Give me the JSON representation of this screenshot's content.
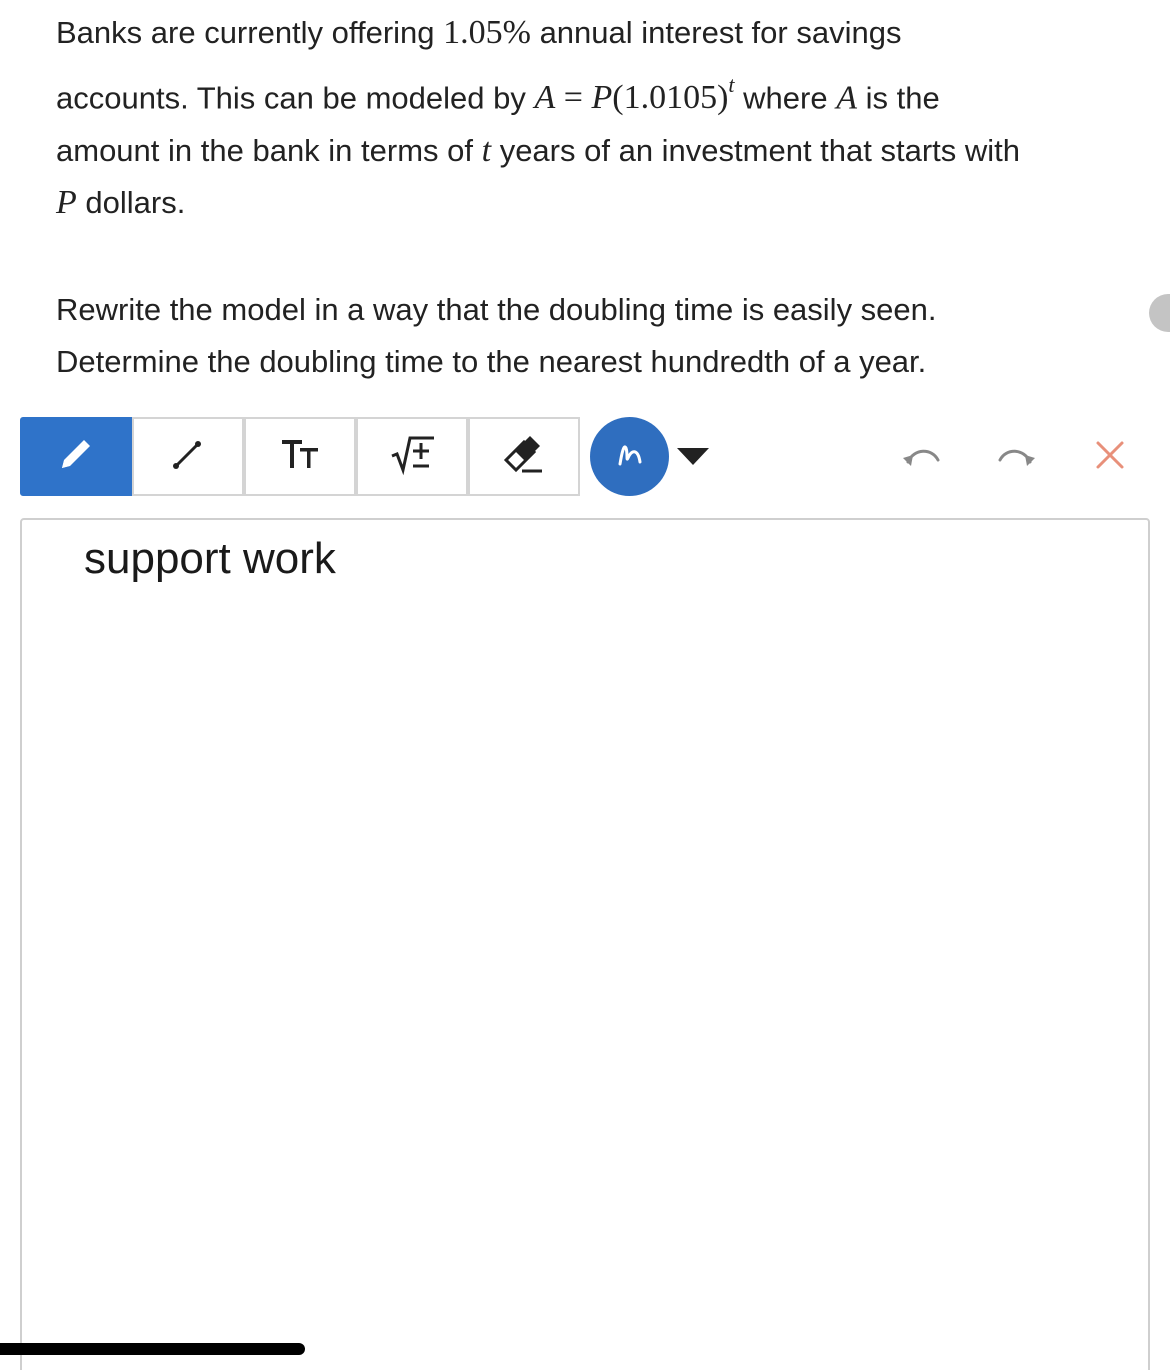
{
  "problem": {
    "p1_line1_a": "Banks are currently offering ",
    "rate": "1.05%",
    "p1_line1_b": " annual interest for savings",
    "p1_line2_a": "accounts. This can be modeled by ",
    "formula_A": "A",
    "formula_eq": " = ",
    "formula_P": "P",
    "formula_base": "(1.0105)",
    "formula_exp": "t",
    "p1_line2_b": " where ",
    "var_A": "A",
    "p1_line2_c": " is the",
    "p1_line3_a": "amount in the bank in terms of ",
    "var_t": "t",
    "p1_line3_b": " years of an investment that starts with",
    "var_P": "P",
    "p1_line4": " dollars.",
    "p2_line1": "Rewrite the model in a way that the doubling time is easily seen.",
    "p2_line2": "Determine the doubling time to the nearest hundredth of a year."
  },
  "toolbar": {
    "tools": [
      {
        "name": "pencil-tool",
        "icon": "pencil-icon",
        "active": true
      },
      {
        "name": "line-tool",
        "icon": "line-icon",
        "active": false
      },
      {
        "name": "text-tool",
        "icon": "text-size-icon",
        "label": "TT",
        "active": false
      },
      {
        "name": "math-tool",
        "icon": "sqrt-plus-minus-icon",
        "label": "√±",
        "active": false
      },
      {
        "name": "eraser-tool",
        "icon": "eraser-icon",
        "active": false
      }
    ],
    "pen_color": "#2f6ebf",
    "active_color": "#2f73c9",
    "clear_color": "#e8907a"
  },
  "canvas": {
    "text": "support work"
  }
}
